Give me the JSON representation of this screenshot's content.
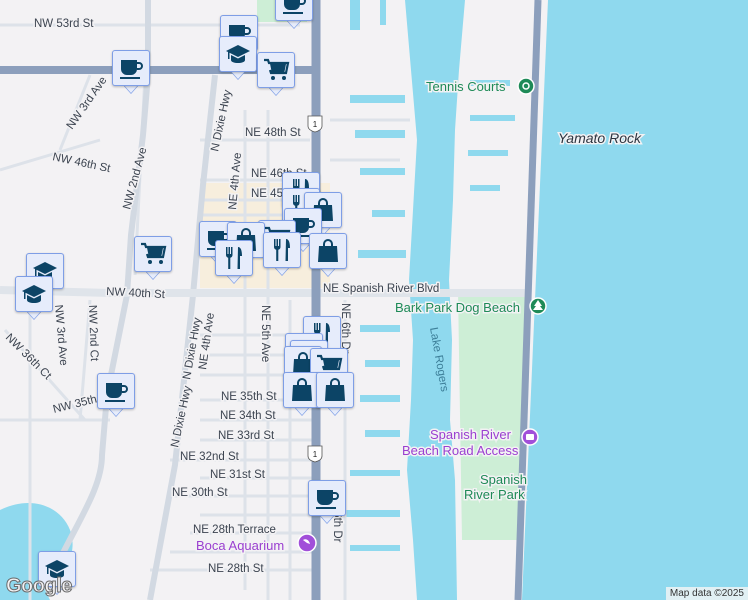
{
  "map": {
    "streets": [
      "NW 53rd St",
      "NW 3rd Ave",
      "NW 46th St",
      "NW 2nd Ave",
      "N Dixie Hwy",
      "NE 48th St",
      "NE 46th St",
      "NE 45th St",
      "NE 4th Ave",
      "NW 40th St",
      "NE Spanish River Blvd",
      "NW 3rd Ave",
      "NW 2nd Ct",
      "NW 36th Ct",
      "N Dixie Hwy",
      "N Dixie Hwy",
      "NE 4th Ave",
      "NE 5th Ave",
      "NE 6th Dr",
      "NW 35th St",
      "NE 35th St",
      "NE 34th St",
      "NE 33rd St",
      "NE 32nd St",
      "NE 31st St",
      "NE 30th St",
      "NE 28th Terrace",
      "NE 28th St",
      "NE 6th Dr"
    ],
    "route_shield": "1",
    "water_label": "Lake Rogers",
    "landmark": "Yamato Rock",
    "pois": {
      "tennis": "Tennis Courts",
      "bark_park": "Bark Park Dog Beach",
      "beach_access_1": "Spanish River",
      "beach_access_2": "Beach Road Access",
      "park_1": "Spanish",
      "park_2": "River Park",
      "aquarium": "Boca Aquarium"
    },
    "colors": {
      "water": "#8fd9ee",
      "park": "#cdeed6",
      "highway": "#8c9fbc",
      "road": "#dde2e9",
      "marker_icon": "#0c4466"
    }
  },
  "markers": [
    "coffee",
    "coffee",
    "school",
    "cart",
    "coffee",
    "restaurant",
    "restaurant",
    "shopping",
    "coffee",
    "cart",
    "coffee",
    "shopping",
    "restaurant",
    "restaurant",
    "shopping",
    "cart",
    "school",
    "school",
    "restaurant",
    "restaurant",
    "restaurant",
    "shopping",
    "cart",
    "shopping",
    "shopping",
    "coffee",
    "coffee",
    "school"
  ],
  "footer": {
    "logo": "Google",
    "attribution": "Map data ©2025"
  }
}
